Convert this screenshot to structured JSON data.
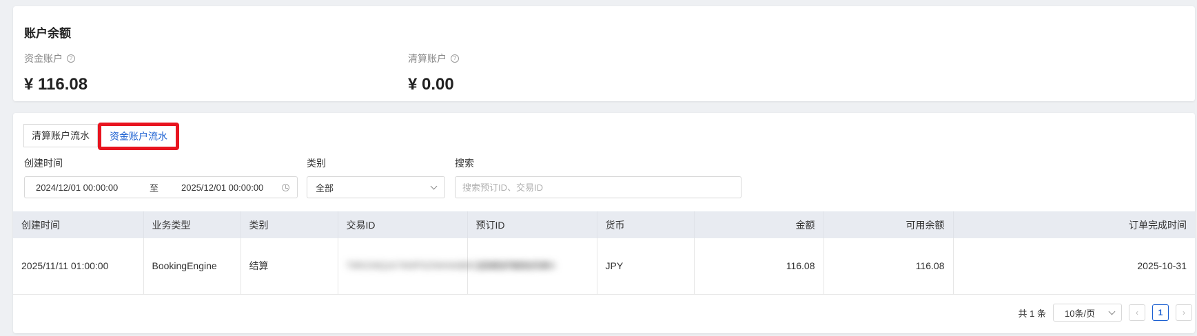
{
  "balance": {
    "title": "账户余额",
    "fund_account_label": "资金账户",
    "fund_account_value": "¥ 116.08",
    "clearing_account_label": "清算账户",
    "clearing_account_value": "¥ 0.00",
    "help_icon": "?"
  },
  "tabs": [
    {
      "label": "清算账户流水",
      "active": false
    },
    {
      "label": "资金账户流水",
      "active": true
    }
  ],
  "filters": {
    "created_time_label": "创建时间",
    "date_start": "2024/12/01 00:00:00",
    "date_sep": "至",
    "date_end": "2025/12/01 00:00:00",
    "category_label": "类别",
    "category_value": "全部",
    "search_label": "搜索",
    "search_placeholder": "搜索预订ID、交易ID"
  },
  "table": {
    "headers": [
      "创建时间",
      "业务类型",
      "类别",
      "交易ID",
      "预订ID",
      "货币",
      "金额",
      "可用余额",
      "订单完成时间"
    ],
    "rows": [
      {
        "created": "2025/11/11 01:00:00",
        "business_type": "BookingEngine",
        "category": "结算",
        "transaction_id": "T9R2X8Q1K7M3P5Z0W4A6B8C2D0E1F3G5H7J9",
        "booking_id": "1234567890123456",
        "currency": "JPY",
        "amount": "116.08",
        "available_balance": "116.08",
        "order_completed": "2025-10-31"
      }
    ]
  },
  "pager": {
    "total": "共 1 条",
    "page_size": "10条/页",
    "current_page": "1",
    "prev": "‹",
    "next": "›"
  },
  "colors": {
    "accent": "#1a5fd1",
    "highlight_border": "#e8141f",
    "header_bg": "#e8ebf1"
  }
}
